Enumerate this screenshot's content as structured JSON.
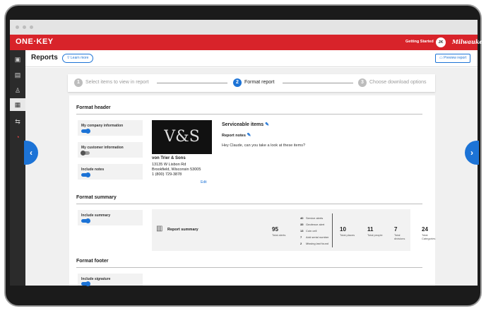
{
  "topbar": {
    "logo": "ONE·KEY",
    "getting_started": "Getting Started",
    "avatar": "JK",
    "brand": "Milwaukee"
  },
  "sidebar": {
    "items": [
      "toolbox-icon",
      "map-icon",
      "person-icon",
      "report-icon",
      "transfer-icon",
      "alert-icon"
    ]
  },
  "header": {
    "title": "Reports",
    "learn_more": "Learn more",
    "preview": "Preview report"
  },
  "stepper": {
    "steps": [
      {
        "num": "1",
        "label": "Select items to view in report"
      },
      {
        "num": "2",
        "label": "Format report"
      },
      {
        "num": "3",
        "label": "Choose download options"
      }
    ]
  },
  "format_header": {
    "title": "Format header",
    "options": [
      {
        "label": "My company information",
        "on": true
      },
      {
        "label": "My customer information",
        "on": false
      },
      {
        "label": "Include notes",
        "on": true
      }
    ],
    "logo_text": "V&S",
    "company": {
      "name": "von Trier & Sons",
      "street": "13135 W Lisbon Rd",
      "city": "Brookfield, Wisconsin 53005",
      "phone": "1 (800) 729-3878"
    },
    "edit": "Edit",
    "report_title": "Serviceable items",
    "notes_title": "Report notes",
    "notes_body": "Hey Claude, can you take a look at these items?"
  },
  "format_summary": {
    "title": "Format summary",
    "option": "Include summary",
    "label": "Report summary",
    "total_alerts": {
      "num": "95",
      "label": "Total alerts"
    },
    "alerts": [
      {
        "n": "40",
        "label": "Service alerts"
      },
      {
        "n": "35",
        "label": "Geofence alert"
      },
      {
        "n": "13",
        "label": "Coin cell"
      },
      {
        "n": "7",
        "label": "Add serial number"
      },
      {
        "n": "2",
        "label": "Missing last found"
      }
    ],
    "stats": [
      {
        "num": "10",
        "label": "Total places"
      },
      {
        "num": "11",
        "label": "Total people"
      },
      {
        "num": "7",
        "label": "Total divisions"
      },
      {
        "num": "24",
        "label": "Total Categories"
      }
    ]
  },
  "format_footer": {
    "title": "Format footer",
    "option": "Include signature"
  },
  "colors": {
    "accent": "#1c73d6",
    "brand": "#d8232a"
  }
}
